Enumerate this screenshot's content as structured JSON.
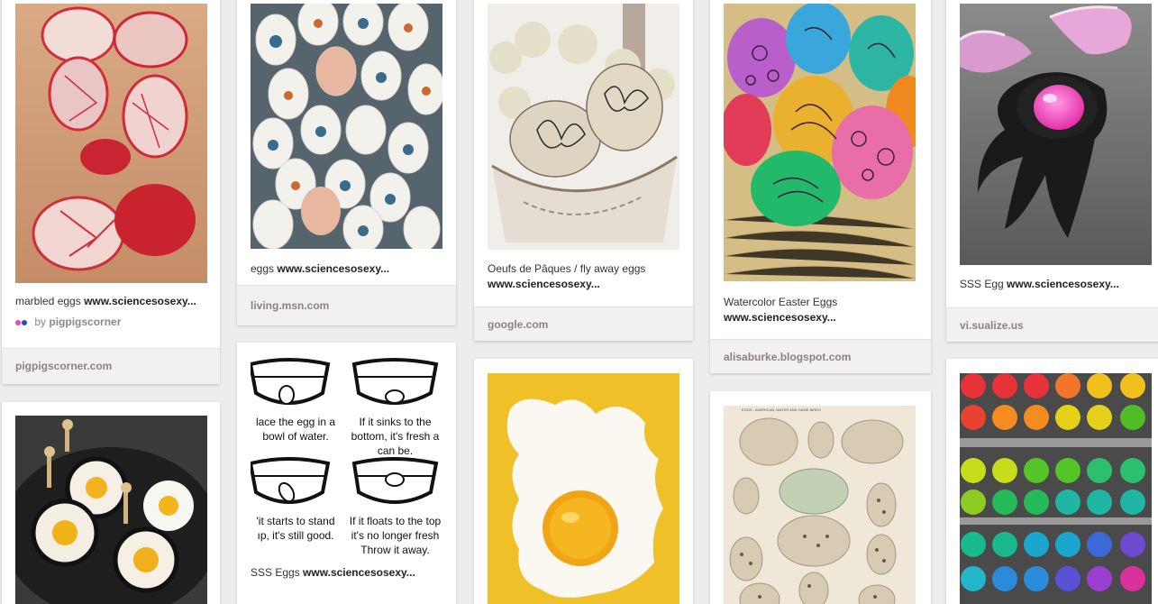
{
  "pins": {
    "marbled": {
      "desc": "marbled eggs",
      "domain": "www.sciencesosexy...",
      "via_prefix": "by",
      "via_user": "pigpigscorner",
      "source": "pigpigscorner.com",
      "colors": {
        "dot_pink": "#ea4aa1",
        "dot_blue": "#2a4bd0"
      }
    },
    "butterfly_eggs": {
      "desc": "eggs",
      "domain": "www.sciencesosexy...",
      "source": "living.msn.com"
    },
    "oeufs": {
      "desc": "Oeufs de Pâques / fly away eggs",
      "domain": "www.sciencesosexy...",
      "source": "google.com"
    },
    "watercolor": {
      "desc": "Watercolor Easter Eggs",
      "domain": "www.sciencesosexy...",
      "source": "alisaburke.blogspot.com"
    },
    "sss_egg": {
      "desc": "SSS Egg",
      "domain": "www.sciencesosexy...",
      "source": "vi.sualize.us"
    },
    "egg_test": {
      "desc": "SSS Eggs",
      "domain": "www.sciencesosexy...",
      "steps": [
        {
          "line1": "lace the egg in a",
          "line2": "bowl of water."
        },
        {
          "line1": "If it sinks to the",
          "line2": "bottom, it's fresh a",
          "line3": "can be."
        },
        {
          "line1": "'it starts to stand",
          "line2": "ıp, it's still  good."
        },
        {
          "line1": "If it floats to the top",
          "line2": "it's no longer fresh",
          "line3": "Throw it away."
        }
      ]
    },
    "frying_pan": {
      "icon": "flower-egg-ring-photo"
    },
    "fried_egg": {
      "icon": "fried-egg-photo"
    },
    "egg_chart": {
      "caption": "EGGS - AMERICAN, WATER AND GAME BIRDS"
    },
    "rainbow": {
      "icon": "rainbow-eggs-photo"
    }
  }
}
